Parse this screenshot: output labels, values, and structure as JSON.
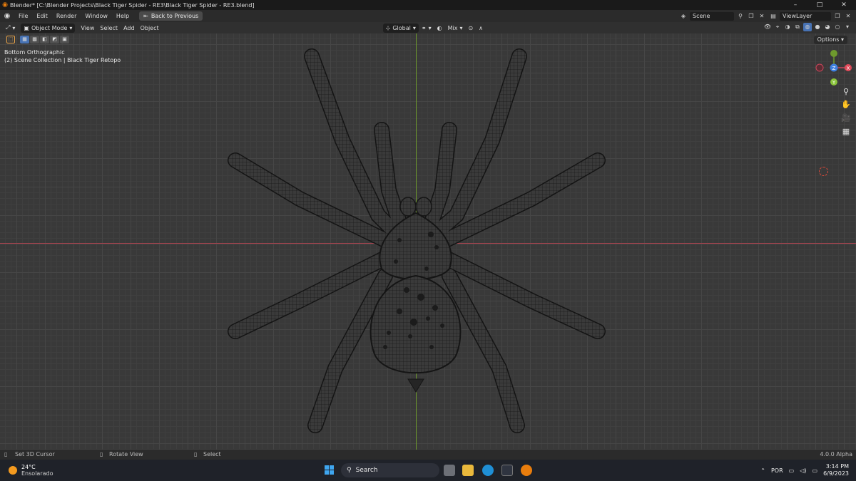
{
  "window": {
    "title": "Blender* [C:\\Blender Projects\\Black Tiger Spider - RE3\\Black Tiger Spider - RE3.blend]",
    "controls": [
      "–",
      "□",
      "✕"
    ]
  },
  "menubar": {
    "items": [
      "File",
      "Edit",
      "Render",
      "Window",
      "Help"
    ],
    "back_button": "Back to Previous"
  },
  "scene": {
    "label": "Scene"
  },
  "view_layer": {
    "label": "ViewLayer"
  },
  "header": {
    "mode": "Object Mode",
    "menus": [
      "View",
      "Select",
      "Add",
      "Object"
    ],
    "orientation": "Global",
    "snap": "Mix"
  },
  "viewport": {
    "view_name": "Bottom Orthographic",
    "collection_info": "(2) Scene Collection | Black Tiger Retopo",
    "options_label": "Options",
    "gizmo_labels": {
      "x": "X",
      "y": "Y",
      "z": "Z"
    }
  },
  "statusbar": {
    "left": "Set 3D Cursor",
    "middle": "Rotate View",
    "right": "Select",
    "version": "4.0.0 Alpha"
  },
  "taskbar": {
    "temperature": "24°C",
    "weather": "Ensolarado",
    "search": "Search",
    "language": "POR",
    "time": "3:14 PM",
    "date": "6/9/2023"
  },
  "colors": {
    "x_axis": "#a8434f",
    "y_axis": "#6e9a2d",
    "accent": "#4772b3",
    "blender_orange": "#e87d0d"
  }
}
